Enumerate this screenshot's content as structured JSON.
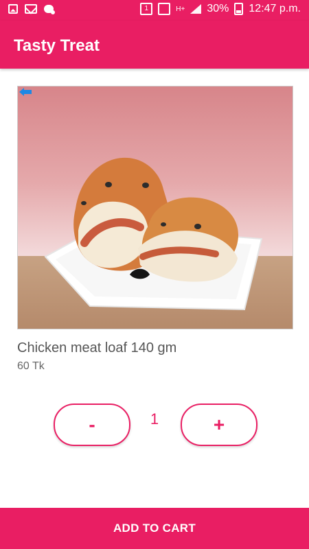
{
  "status_bar": {
    "time": "12:47 p.m.",
    "battery": "30%",
    "sim_label": "1",
    "network_label": "H+",
    "icons": [
      "photo-icon",
      "mail-icon",
      "chat-icon",
      "sim-icon",
      "signal-icon",
      "battery-icon"
    ]
  },
  "app_bar": {
    "title": "Tasty Treat"
  },
  "product": {
    "name": "Chicken meat loaf 140 gm",
    "price": "60 Tk",
    "image_icon": "back-arrow-icon"
  },
  "quantity": {
    "minus_label": "-",
    "value": "1",
    "plus_label": "+"
  },
  "cart": {
    "button_label": "ADD TO CART"
  },
  "colors": {
    "primary": "#e91e63"
  }
}
